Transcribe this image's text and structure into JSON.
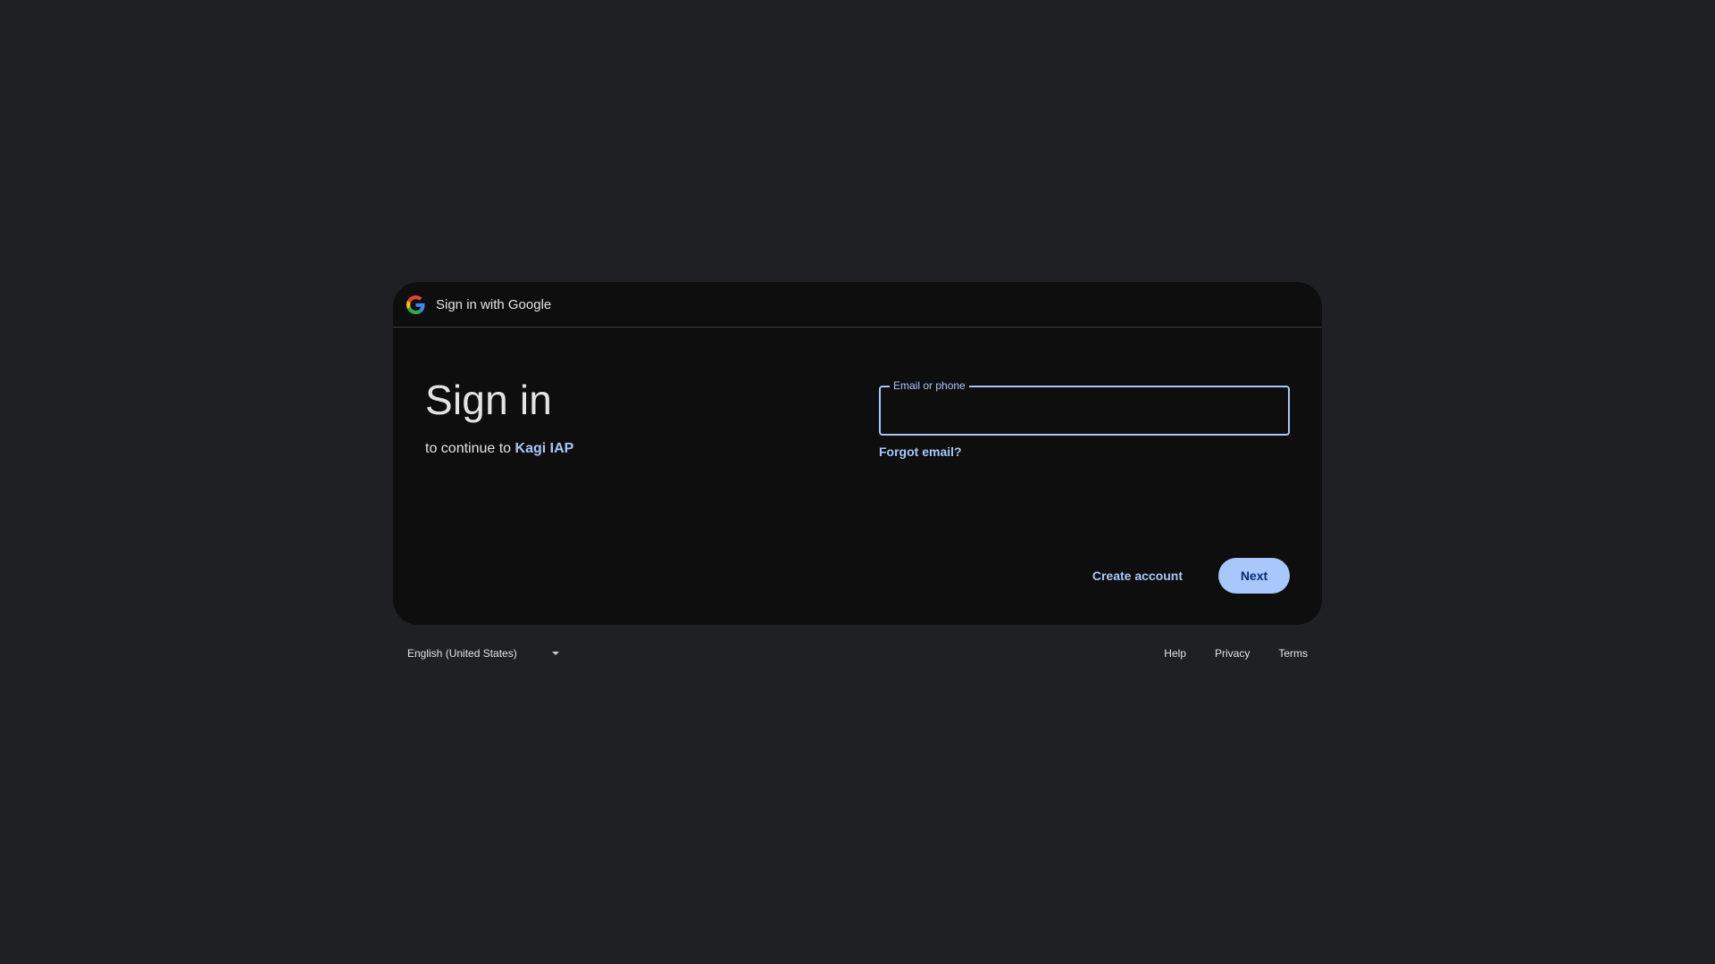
{
  "header": {
    "title": "Sign in with Google"
  },
  "main": {
    "title": "Sign in",
    "subtitle_prefix": "to continue to ",
    "app_name": "Kagi IAP"
  },
  "form": {
    "email_label": "Email or phone",
    "email_value": "",
    "forgot_email": "Forgot email?"
  },
  "actions": {
    "create_account": "Create account",
    "next": "Next"
  },
  "footer": {
    "language": "English (United States)",
    "help": "Help",
    "privacy": "Privacy",
    "terms": "Terms"
  },
  "colors": {
    "background": "#1f2023",
    "card": "#0e0e0e",
    "accent": "#a8c7fa",
    "primary_text": "#062e6f"
  },
  "icons": {
    "logo": "google-g-icon",
    "language_caret": "caret-down-icon"
  }
}
